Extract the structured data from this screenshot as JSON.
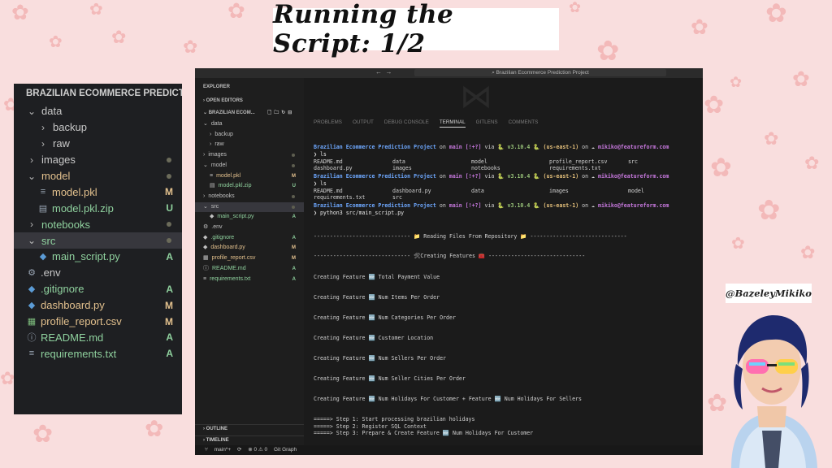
{
  "slide_title": "Running the Script: 1/2",
  "handle": "@BazeleyMikiko",
  "big_explorer": {
    "header": "BRAZILIAN ECOMMERCE PREDICTIO...",
    "items": [
      {
        "label": "data",
        "chev": "⌄",
        "indent": 0,
        "badge": "",
        "dot": false
      },
      {
        "label": "backup",
        "chev": "›",
        "indent": 1,
        "badge": "",
        "dot": false
      },
      {
        "label": "raw",
        "chev": "›",
        "indent": 1,
        "badge": "",
        "dot": false
      },
      {
        "label": "images",
        "chev": "›",
        "indent": 0,
        "badge": "",
        "dot": true
      },
      {
        "label": "model",
        "chev": "⌄",
        "indent": 0,
        "badge": "",
        "dot": true,
        "color": "orange"
      },
      {
        "label": "model.pkl",
        "icon": "≡",
        "indent": 1,
        "badge": "M",
        "color": "orange"
      },
      {
        "label": "model.pkl.zip",
        "icon": "▤",
        "indent": 1,
        "badge": "U",
        "color": "green"
      },
      {
        "label": "notebooks",
        "chev": "›",
        "indent": 0,
        "badge": "",
        "dot": true,
        "color": "green"
      },
      {
        "label": "src",
        "chev": "⌄",
        "indent": 0,
        "badge": "",
        "dot": true,
        "color": "green",
        "selected": true
      },
      {
        "label": "main_script.py",
        "icon": "◆",
        "indent": 1,
        "badge": "A",
        "color": "green"
      },
      {
        "label": ".env",
        "icon": "⚙",
        "indent": 0,
        "badge": ""
      },
      {
        "label": ".gitignore",
        "icon": "◆",
        "indent": 0,
        "badge": "A",
        "color": "green"
      },
      {
        "label": "dashboard.py",
        "icon": "◆",
        "indent": 0,
        "badge": "M",
        "color": "orange"
      },
      {
        "label": "profile_report.csv",
        "icon": "▦",
        "indent": 0,
        "badge": "M",
        "color": "orange"
      },
      {
        "label": "README.md",
        "icon": "ⓘ",
        "indent": 0,
        "badge": "A",
        "color": "green"
      },
      {
        "label": "requirements.txt",
        "icon": "≡",
        "indent": 0,
        "badge": "A",
        "color": "green"
      }
    ]
  },
  "vscode": {
    "title_search": "Brazilian Ecommerce Prediction Project",
    "sidebar": {
      "explorer_label": "EXPLORER",
      "open_editors": "OPEN EDITORS",
      "project": "BRAZILIAN ECOM...",
      "items": [
        {
          "label": "data",
          "prefix": "⌄",
          "indent": 0,
          "badge": ""
        },
        {
          "label": "backup",
          "prefix": "›",
          "indent": 1,
          "badge": ""
        },
        {
          "label": "raw",
          "prefix": "›",
          "indent": 1,
          "badge": ""
        },
        {
          "label": "images",
          "prefix": "›",
          "indent": 0,
          "badge": "",
          "dot": true
        },
        {
          "label": "model",
          "prefix": "⌄",
          "indent": 0,
          "badge": "",
          "dot": true
        },
        {
          "label": "model.pkl",
          "prefix": "≡",
          "indent": 1,
          "badge": "M"
        },
        {
          "label": "model.pkl.zip",
          "prefix": "▤",
          "indent": 1,
          "badge": "U"
        },
        {
          "label": "notebooks",
          "prefix": "›",
          "indent": 0,
          "badge": "",
          "dot": true
        },
        {
          "label": "src",
          "prefix": "⌄",
          "indent": 0,
          "badge": "",
          "dot": true,
          "selected": true
        },
        {
          "label": "main_script.py",
          "prefix": "◆",
          "indent": 1,
          "badge": "A"
        },
        {
          "label": ".env",
          "prefix": "⚙",
          "indent": 0,
          "badge": ""
        },
        {
          "label": ".gitignore",
          "prefix": "◆",
          "indent": 0,
          "badge": "A"
        },
        {
          "label": "dashboard.py",
          "prefix": "◆",
          "indent": 0,
          "badge": "M"
        },
        {
          "label": "profile_report.csv",
          "prefix": "▦",
          "indent": 0,
          "badge": "M"
        },
        {
          "label": "README.md",
          "prefix": "ⓘ",
          "indent": 0,
          "badge": "A"
        },
        {
          "label": "requirements.txt",
          "prefix": "≡",
          "indent": 0,
          "badge": "A"
        }
      ],
      "outline": "OUTLINE",
      "timeline": "TIMELINE"
    },
    "panel_tabs": [
      "PROBLEMS",
      "OUTPUT",
      "DEBUG CONSOLE",
      "TERMINAL",
      "GITLENS",
      "COMMENTS"
    ],
    "active_tab": "TERMINAL",
    "prompt": {
      "project": "Brazilian Ecommerce Prediction Project",
      "on": "on",
      "branch": "main [!+?]",
      "via": "via",
      "python": "v3.10.4",
      "region": "(us-east-1)",
      "user": "mikiko@featureform.com"
    },
    "terminal_lines": [
      {
        "kind": "prompt"
      },
      {
        "kind": "cmd",
        "text": "❯ ls"
      },
      {
        "kind": "cols",
        "cells": [
          "README.md",
          "data",
          "model",
          "profile_report.csv",
          "src"
        ]
      },
      {
        "kind": "cols",
        "cells": [
          "dashboard.py",
          "images",
          "notebooks",
          "requirements.txt",
          ""
        ]
      },
      {
        "kind": "prompt"
      },
      {
        "kind": "cmd",
        "text": "❯ ls"
      },
      {
        "kind": "cols",
        "cells": [
          "README.md",
          "dashboard.py",
          "data",
          "images",
          "model"
        ]
      },
      {
        "kind": "cols",
        "cells": [
          "requirements.txt",
          "src",
          "",
          "",
          ""
        ]
      },
      {
        "kind": "prompt"
      },
      {
        "kind": "cmd",
        "text": "❯ python3 src/main_script.py"
      },
      {
        "kind": "text",
        "text": "------------------------------ 📁 Reading Files From Repository 📁 ------------------------------"
      },
      {
        "kind": "text",
        "text": "------------------------------ 🛠Creating Features 🧰 ------------------------------"
      },
      {
        "kind": "text",
        "text": "Creating Feature 🆕 Total Payment Value"
      },
      {
        "kind": "text",
        "text": "Creating Feature 🆕 Num Items Per Order"
      },
      {
        "kind": "text",
        "text": "Creating Feature 🆕 Num Categories Per Order"
      },
      {
        "kind": "text",
        "text": "Creating Feature 🆕 Customer Location"
      },
      {
        "kind": "text",
        "text": "Creating Feature 🆕 Num Sellers Per Order"
      },
      {
        "kind": "text",
        "text": "Creating Feature 🆕 Num Seller Cities Per Order"
      },
      {
        "kind": "text",
        "text": "Creating Feature 🆕 Num Holidays For Customer + Feature 🆕 Num Holidays For Sellers"
      },
      {
        "kind": "text",
        "text": "=====> Step 1: Start processing brazilian holidays"
      },
      {
        "kind": "text",
        "text": "=====> Step 2: Register SQL Context"
      },
      {
        "kind": "text",
        "text": "=====> Step 3: Prepare & Create Feature 🆕 Num Holidays For Customer"
      }
    ],
    "status_bar": {
      "branch": "main*+",
      "sync": "⟳",
      "errors": "⊗ 0 ⚠ 0",
      "graph": "Git Graph"
    }
  }
}
